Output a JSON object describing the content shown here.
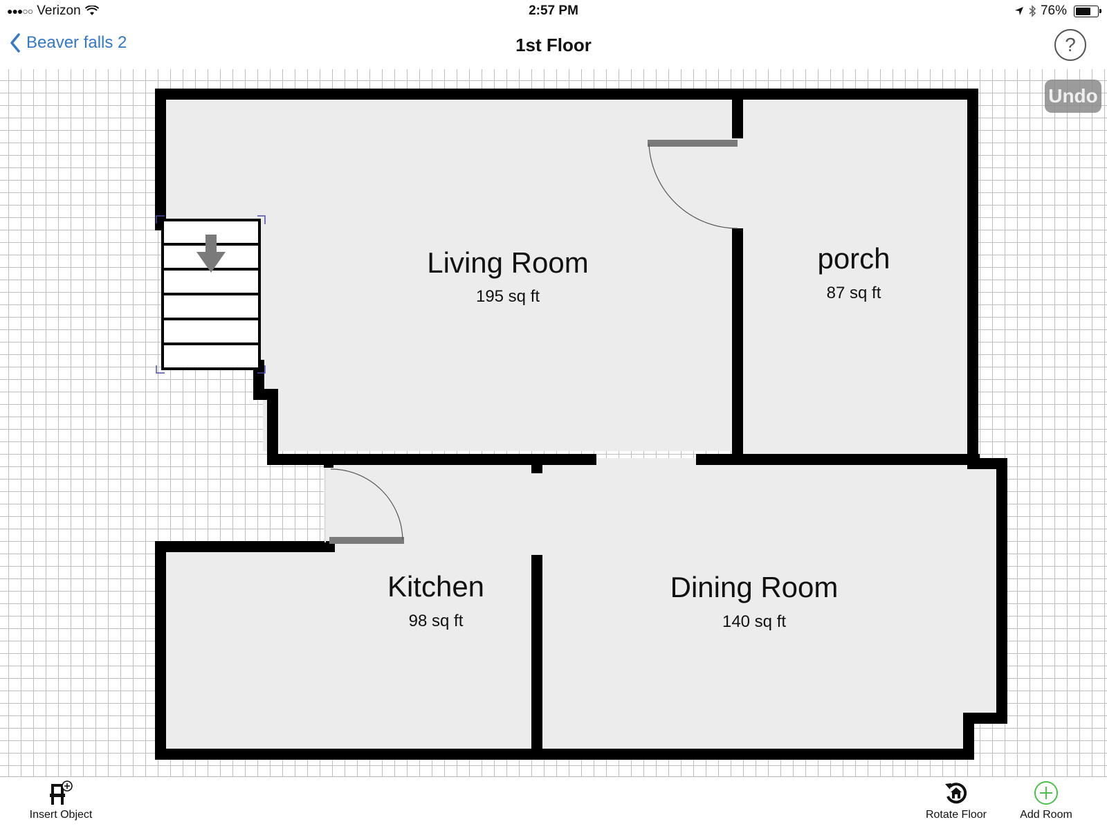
{
  "status_bar": {
    "signal_dots": "●●●○○",
    "carrier": "Verizon",
    "wifi_icon": "wifi-icon",
    "time": "2:57 PM",
    "location_icon": "location-arrow-icon",
    "bluetooth_icon": "bluetooth-icon",
    "battery_percent": "76%",
    "battery_level": 0.76
  },
  "nav": {
    "back_label": "Beaver falls 2",
    "title": "1st Floor",
    "help_label": "?"
  },
  "canvas": {
    "undo_label": "Undo",
    "rooms": [
      {
        "name": "Living Room",
        "area": "195 sq ft"
      },
      {
        "name": "porch",
        "area": "87 sq ft"
      },
      {
        "name": "Kitchen",
        "area": "98 sq ft"
      },
      {
        "name": "Dining Room",
        "area": "140 sq ft"
      }
    ],
    "stairs_icon": "stairs-down-icon"
  },
  "toolbar": {
    "insert_label": "Insert Object",
    "rotate_label": "Rotate Floor",
    "add_label": "Add Room"
  },
  "colors": {
    "accent": "#3478c8",
    "add_green": "#4cc04c",
    "room_fill": "#ececec",
    "wall": "#000000",
    "door": "#7a7a7a"
  }
}
